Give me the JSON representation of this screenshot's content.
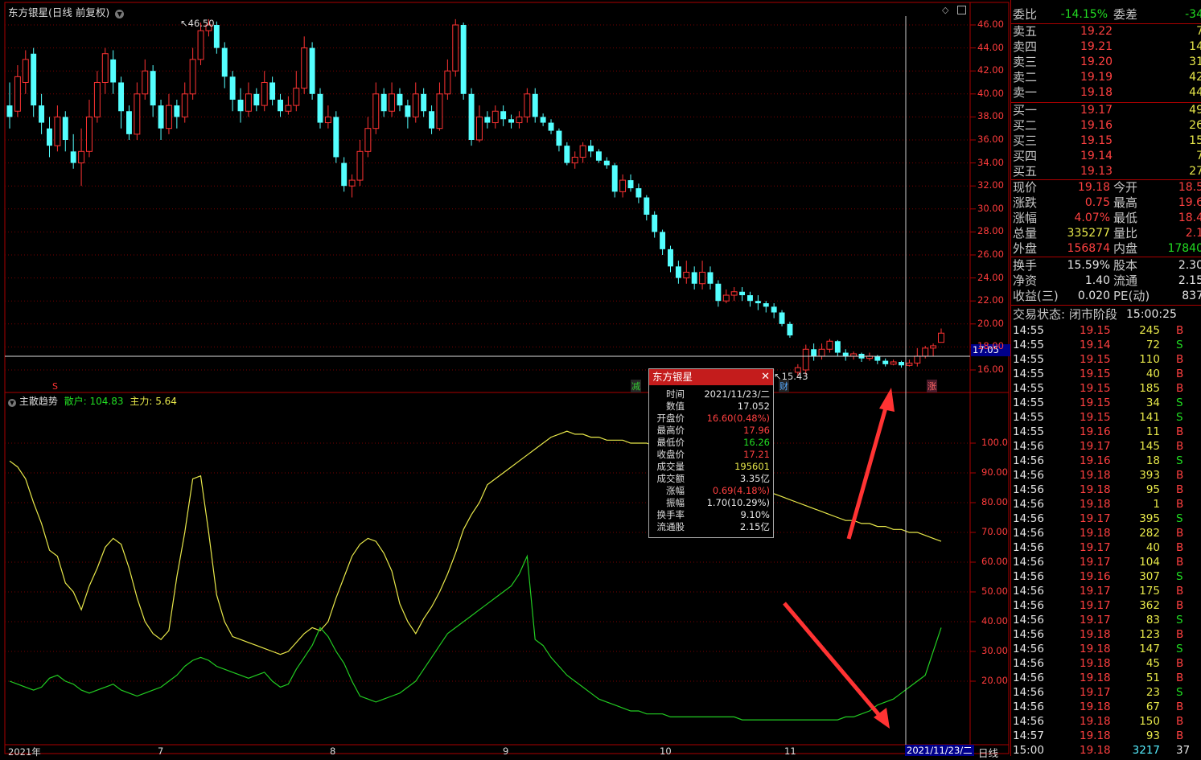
{
  "chart_header": {
    "title": "东方银星(日线 前复权)"
  },
  "indicator_header": {
    "name": "主散趋势",
    "retail_label": "散户: 104.83",
    "main_label": "主力: 5.64"
  },
  "price_axis": [
    "46.00",
    "44.00",
    "42.00",
    "40.00",
    "38.00",
    "36.00",
    "34.00",
    "32.00",
    "30.00",
    "28.00",
    "26.00",
    "24.00",
    "22.00",
    "20.00",
    "18.00",
    "16.00"
  ],
  "indicator_axis": [
    "100.0",
    "90.00",
    "80.00",
    "70.00",
    "60.00",
    "50.00",
    "40.00",
    "30.00",
    "20.00"
  ],
  "crosshair_price": "17.05",
  "max_marker": "46.50",
  "min_marker": "15.43",
  "markers": {
    "s": "S",
    "jian": "减",
    "cai": "财",
    "zhang": "涨"
  },
  "x_axis": {
    "year": "2021年",
    "m7": "7",
    "m8": "8",
    "m9": "9",
    "m10": "10",
    "m11": "11",
    "date": "2021/11/23/二",
    "period": "日线"
  },
  "popup": {
    "title": "东方银星",
    "rows": [
      {
        "k": "时间",
        "v": "2021/11/23/二",
        "c": "white"
      },
      {
        "k": "数值",
        "v": "17.052",
        "c": "white"
      },
      {
        "k": "开盘价",
        "v": "16.60(0.48%)",
        "c": "red"
      },
      {
        "k": "最高价",
        "v": "17.96",
        "c": "red"
      },
      {
        "k": "最低价",
        "v": "16.26",
        "c": "green"
      },
      {
        "k": "收盘价",
        "v": "17.21",
        "c": "red"
      },
      {
        "k": "成交量",
        "v": "195601",
        "c": "yellow"
      },
      {
        "k": "成交额",
        "v": "3.35亿",
        "c": "white"
      },
      {
        "k": "涨幅",
        "v": "0.69(4.18%)",
        "c": "red"
      },
      {
        "k": "振幅",
        "v": "1.70(10.29%)",
        "c": "white"
      },
      {
        "k": "换手率",
        "v": "9.10%",
        "c": "white"
      },
      {
        "k": "流通股",
        "v": "2.15亿",
        "c": "white"
      }
    ]
  },
  "quote": {
    "weibi": {
      "label": "委比",
      "value": "-14.15%",
      "label2": "委差",
      "value2": "-34"
    },
    "asks": [
      {
        "label": "卖五",
        "price": "19.22",
        "vol": "7"
      },
      {
        "label": "卖四",
        "price": "19.21",
        "vol": "14"
      },
      {
        "label": "卖三",
        "price": "19.20",
        "vol": "31"
      },
      {
        "label": "卖二",
        "price": "19.19",
        "vol": "42"
      },
      {
        "label": "卖一",
        "price": "19.18",
        "vol": "44"
      }
    ],
    "bids": [
      {
        "label": "买一",
        "price": "19.17",
        "vol": "49"
      },
      {
        "label": "买二",
        "price": "19.16",
        "vol": "26"
      },
      {
        "label": "买三",
        "price": "19.15",
        "vol": "15"
      },
      {
        "label": "买四",
        "price": "19.14",
        "vol": "7"
      },
      {
        "label": "买五",
        "price": "19.13",
        "vol": "27"
      }
    ],
    "stats1": [
      {
        "l1": "现价",
        "v1": "19.18",
        "c1": "red",
        "l2": "今开",
        "v2": "18.5",
        "c2": "red"
      },
      {
        "l1": "涨跌",
        "v1": "0.75",
        "c1": "red",
        "l2": "最高",
        "v2": "19.6",
        "c2": "red"
      },
      {
        "l1": "涨幅",
        "v1": "4.07%",
        "c1": "red",
        "l2": "最低",
        "v2": "18.4",
        "c2": "red"
      },
      {
        "l1": "总量",
        "v1": "335277",
        "c1": "yellow",
        "l2": "量比",
        "v2": "2.1",
        "c2": "red"
      },
      {
        "l1": "外盘",
        "v1": "156874",
        "c1": "red",
        "l2": "内盘",
        "v2": "17840",
        "c2": "green"
      }
    ],
    "stats2": [
      {
        "l1": "换手",
        "v1": "15.59%",
        "c1": "white",
        "l2": "股本",
        "v2": "2.30",
        "c2": "white"
      },
      {
        "l1": "净资",
        "v1": "1.40",
        "c1": "white",
        "l2": "流通",
        "v2": "2.15",
        "c2": "white"
      },
      {
        "l1": "收益(三)",
        "v1": "0.020",
        "c1": "white",
        "l2": "PE(动)",
        "v2": "837",
        "c2": "white"
      }
    ],
    "status": {
      "label": "交易状态: 闭市阶段",
      "time": "15:00:25"
    },
    "trades": [
      {
        "t": "14:55",
        "p": "19.15",
        "v": "245",
        "s": "B"
      },
      {
        "t": "14:55",
        "p": "19.14",
        "v": "72",
        "s": "S"
      },
      {
        "t": "14:55",
        "p": "19.15",
        "v": "110",
        "s": "B"
      },
      {
        "t": "14:55",
        "p": "19.15",
        "v": "40",
        "s": "B"
      },
      {
        "t": "14:55",
        "p": "19.15",
        "v": "185",
        "s": "B"
      },
      {
        "t": "14:55",
        "p": "19.15",
        "v": "34",
        "s": "S"
      },
      {
        "t": "14:55",
        "p": "19.15",
        "v": "141",
        "s": "S"
      },
      {
        "t": "14:55",
        "p": "19.16",
        "v": "11",
        "s": "B"
      },
      {
        "t": "14:56",
        "p": "19.17",
        "v": "145",
        "s": "B"
      },
      {
        "t": "14:56",
        "p": "19.16",
        "v": "18",
        "s": "S"
      },
      {
        "t": "14:56",
        "p": "19.18",
        "v": "393",
        "s": "B"
      },
      {
        "t": "14:56",
        "p": "19.18",
        "v": "95",
        "s": "B"
      },
      {
        "t": "14:56",
        "p": "19.18",
        "v": "1",
        "s": "B"
      },
      {
        "t": "14:56",
        "p": "19.17",
        "v": "395",
        "s": "S"
      },
      {
        "t": "14:56",
        "p": "19.18",
        "v": "282",
        "s": "B"
      },
      {
        "t": "14:56",
        "p": "19.17",
        "v": "40",
        "s": "B"
      },
      {
        "t": "14:56",
        "p": "19.17",
        "v": "104",
        "s": "B"
      },
      {
        "t": "14:56",
        "p": "19.16",
        "v": "307",
        "s": "S"
      },
      {
        "t": "14:56",
        "p": "19.17",
        "v": "175",
        "s": "B"
      },
      {
        "t": "14:56",
        "p": "19.17",
        "v": "362",
        "s": "B"
      },
      {
        "t": "14:56",
        "p": "19.17",
        "v": "83",
        "s": "S"
      },
      {
        "t": "14:56",
        "p": "19.18",
        "v": "123",
        "s": "B"
      },
      {
        "t": "14:56",
        "p": "19.18",
        "v": "147",
        "s": "S"
      },
      {
        "t": "14:56",
        "p": "19.18",
        "v": "45",
        "s": "B"
      },
      {
        "t": "14:56",
        "p": "19.18",
        "v": "51",
        "s": "B"
      },
      {
        "t": "14:56",
        "p": "19.17",
        "v": "23",
        "s": "S"
      },
      {
        "t": "14:56",
        "p": "19.18",
        "v": "67",
        "s": "B"
      },
      {
        "t": "14:56",
        "p": "19.18",
        "v": "150",
        "s": "B"
      },
      {
        "t": "14:57",
        "p": "19.18",
        "v": "93",
        "s": "B"
      },
      {
        "t": "15:00",
        "p": "19.18",
        "v": "3217",
        "s": "37"
      }
    ]
  },
  "colors": {
    "up": "#ff3333",
    "down": "#54ffff",
    "retail": "#e8e84a",
    "main": "#22cc22",
    "grid": "#7a0000"
  },
  "chart_data": {
    "type": "candlestick",
    "title": "东方银星(日线 前复权)",
    "ylim": [
      15,
      47
    ],
    "candles": [
      [
        39,
        38,
        41,
        37
      ],
      [
        38.5,
        41.5,
        42.5,
        38
      ],
      [
        41,
        43,
        43.8,
        40
      ],
      [
        43.5,
        39,
        44,
        38
      ],
      [
        39,
        37.5,
        40,
        36.5
      ],
      [
        37,
        35.5,
        38,
        34.5
      ],
      [
        35.5,
        38,
        39,
        35
      ],
      [
        38,
        36,
        38.5,
        35
      ],
      [
        35,
        34,
        36.5,
        33.5
      ],
      [
        34,
        35,
        37,
        32
      ],
      [
        35,
        38,
        39.5,
        34.5
      ],
      [
        38,
        41,
        42,
        37.5
      ],
      [
        41,
        43.5,
        44,
        40
      ],
      [
        43,
        41,
        43.8,
        40
      ],
      [
        41,
        38.5,
        41.5,
        37
      ],
      [
        38.5,
        36.5,
        39,
        36
      ],
      [
        36.5,
        40,
        41,
        36
      ],
      [
        40,
        42,
        43,
        39.5
      ],
      [
        42,
        39,
        42.5,
        38
      ],
      [
        39,
        37,
        39.5,
        36
      ],
      [
        37,
        39,
        40,
        36.5
      ],
      [
        39,
        38,
        39.5,
        37
      ],
      [
        38,
        40,
        41,
        37.5
      ],
      [
        40,
        43,
        44,
        39.5
      ],
      [
        43,
        45.5,
        46.2,
        42.5
      ],
      [
        45.5,
        46,
        46.5,
        45
      ],
      [
        46,
        44,
        46.3,
        43.5
      ],
      [
        44,
        41.5,
        44.5,
        40.5
      ],
      [
        41.5,
        39.5,
        42,
        38.5
      ],
      [
        39.5,
        38.5,
        40.5,
        37.5
      ],
      [
        38.5,
        40,
        41,
        38
      ],
      [
        40,
        39,
        40.5,
        38.5
      ],
      [
        39,
        41,
        42,
        38.5
      ],
      [
        41,
        39.5,
        41.5,
        39
      ],
      [
        39.5,
        38.5,
        40,
        38
      ],
      [
        38.5,
        39,
        39.8,
        38.2
      ],
      [
        39,
        40.5,
        42,
        38.5
      ],
      [
        40.5,
        44,
        45,
        40
      ],
      [
        44,
        40,
        44.5,
        39.5
      ],
      [
        40,
        37.5,
        40.5,
        37
      ],
      [
        37.5,
        38,
        39,
        37
      ],
      [
        38,
        34.5,
        38.5,
        34
      ],
      [
        34,
        32,
        34.5,
        31.5
      ],
      [
        32,
        32.5,
        33,
        31
      ],
      [
        32.5,
        35,
        36,
        32
      ],
      [
        35,
        37,
        38,
        34.5
      ],
      [
        37,
        40,
        41,
        36.5
      ],
      [
        40,
        38.5,
        40.5,
        38
      ],
      [
        38.5,
        40,
        41,
        38
      ],
      [
        40,
        39,
        40.5,
        38.5
      ],
      [
        39,
        38,
        39.5,
        37
      ],
      [
        38,
        40,
        41,
        37.5
      ],
      [
        40,
        38.5,
        40.5,
        38
      ],
      [
        38.5,
        37,
        39,
        36.5
      ],
      [
        37,
        40,
        41,
        36.8
      ],
      [
        40,
        42,
        43,
        39.5
      ],
      [
        42,
        46,
        46.5,
        41.5
      ],
      [
        46,
        40,
        46.2,
        39.5
      ],
      [
        40,
        36,
        40.5,
        35.5
      ],
      [
        36,
        38,
        39,
        35.8
      ],
      [
        38,
        37.5,
        38.5,
        37
      ],
      [
        37.5,
        38.5,
        39,
        37
      ],
      [
        38.5,
        37.8,
        39,
        37.2
      ],
      [
        37.8,
        37.5,
        38.2,
        37
      ],
      [
        37.5,
        38,
        38.5,
        37
      ],
      [
        38,
        40,
        40.5,
        37.5
      ],
      [
        40,
        38,
        40.5,
        37.5
      ],
      [
        38,
        37.5,
        38.3,
        37.2
      ],
      [
        37.5,
        36.8,
        37.8,
        36.5
      ],
      [
        36.8,
        35.5,
        37,
        35
      ],
      [
        35.5,
        34,
        35.8,
        33.8
      ],
      [
        34,
        34.5,
        35,
        33.5
      ],
      [
        34.5,
        35.5,
        35.8,
        34
      ],
      [
        35.5,
        35,
        36,
        34.5
      ],
      [
        35,
        34.2,
        35.2,
        34
      ],
      [
        34.2,
        33.8,
        34.5,
        33.5
      ],
      [
        33.8,
        31.5,
        34,
        31
      ],
      [
        31.5,
        32.5,
        33,
        31
      ],
      [
        32.5,
        31.8,
        33,
        31.5
      ],
      [
        31.8,
        31,
        32.2,
        30.5
      ],
      [
        31,
        29.5,
        31.2,
        29
      ],
      [
        29.5,
        28,
        29.8,
        27.5
      ],
      [
        28,
        26.5,
        28.2,
        26
      ],
      [
        26.5,
        25,
        26.8,
        24.5
      ],
      [
        25,
        24,
        25.5,
        23.5
      ],
      [
        24,
        24.5,
        25.5,
        23.5
      ],
      [
        24.5,
        23.5,
        25,
        23
      ],
      [
        23.5,
        24.5,
        25.5,
        23
      ],
      [
        24.5,
        23.5,
        25,
        23
      ],
      [
        23.5,
        22,
        23.8,
        21.5
      ],
      [
        22,
        22.5,
        23,
        21.8
      ],
      [
        22.5,
        22.8,
        23.2,
        22
      ],
      [
        22.8,
        22.5,
        23.2,
        22
      ],
      [
        22.5,
        22,
        22.8,
        21.5
      ],
      [
        22,
        21.8,
        22.5,
        21.2
      ],
      [
        21.8,
        21.5,
        22,
        21
      ],
      [
        21.5,
        21,
        21.8,
        20.5
      ],
      [
        21,
        20,
        21.2,
        19.8
      ],
      [
        20,
        19,
        20.2,
        18.8
      ],
      [
        15.8,
        16.2,
        16.5,
        15.4
      ],
      [
        16,
        17.8,
        18.2,
        15.6
      ],
      [
        17.8,
        17.2,
        18.3,
        16.8
      ],
      [
        17.2,
        17.8,
        18.3,
        16.9
      ],
      [
        17.8,
        18.5,
        18.7,
        17.5
      ],
      [
        18.5,
        17.5,
        18.6,
        17.2
      ],
      [
        17.5,
        17.2,
        17.8,
        16.8
      ],
      [
        17.2,
        17.4,
        17.6,
        16.9
      ],
      [
        17.4,
        17,
        17.5,
        16.7
      ],
      [
        17,
        17.2,
        17.5,
        16.8
      ],
      [
        17.2,
        16.8,
        17.3,
        16.5
      ],
      [
        16.8,
        16.5,
        17,
        16.3
      ],
      [
        16.5,
        16.7,
        16.9,
        16.4
      ],
      [
        16.7,
        16.4,
        16.8,
        16.2
      ],
      [
        16.4,
        16.6,
        16.9,
        16.3
      ],
      [
        16.6,
        17.2,
        17.9,
        16.3
      ],
      [
        17.2,
        17.9,
        18.1,
        17
      ],
      [
        17.9,
        18.1,
        18.3,
        17.2
      ],
      [
        18.4,
        19.2,
        19.6,
        18.4
      ]
    ],
    "retail": [
      94,
      92,
      88,
      80,
      73,
      64,
      62,
      53,
      50,
      44,
      52,
      58,
      65,
      68,
      66,
      58,
      48,
      40,
      36,
      34,
      37,
      55,
      70,
      88,
      89,
      70,
      49,
      40,
      35,
      34,
      33,
      32,
      31,
      30,
      29,
      30,
      33,
      36,
      38,
      37,
      40,
      48,
      55,
      62,
      66,
      68,
      67,
      63,
      57,
      46,
      40,
      36,
      41,
      45,
      50,
      56,
      63,
      71,
      76,
      80,
      86,
      88,
      90,
      92,
      94,
      96,
      98,
      100,
      102,
      103,
      104,
      103,
      103,
      102,
      102,
      101,
      101,
      101,
      100,
      100,
      100,
      99,
      99,
      98,
      98,
      97,
      97,
      96,
      95,
      94,
      92,
      90,
      88,
      86,
      85,
      84,
      83,
      82,
      81,
      80,
      79,
      78,
      77,
      76,
      75,
      74,
      74,
      73,
      73,
      72,
      72,
      71,
      71,
      70,
      70,
      69,
      68,
      67
    ],
    "mainforce": [
      20,
      19,
      18,
      17,
      18,
      21,
      22,
      20,
      19,
      17,
      16,
      17,
      18,
      19,
      17,
      16,
      15,
      16,
      17,
      18,
      20,
      22,
      25,
      27,
      28,
      27,
      25,
      24,
      23,
      22,
      21,
      22,
      23,
      20,
      18,
      19,
      24,
      28,
      32,
      38,
      35,
      30,
      26,
      20,
      15,
      14,
      13,
      14,
      15,
      16,
      18,
      20,
      24,
      28,
      32,
      36,
      38,
      40,
      42,
      44,
      46,
      48,
      50,
      52,
      56,
      62,
      34,
      32,
      28,
      25,
      22,
      20,
      18,
      16,
      14,
      13,
      12,
      11,
      10,
      10,
      9,
      9,
      9,
      8,
      8,
      8,
      8,
      8,
      8,
      8,
      8,
      8,
      7,
      7,
      7,
      7,
      7,
      7,
      7,
      7,
      7,
      7,
      7,
      7,
      7,
      8,
      8,
      9,
      10,
      12,
      13,
      14,
      16,
      18,
      20,
      22,
      30,
      38
    ]
  }
}
